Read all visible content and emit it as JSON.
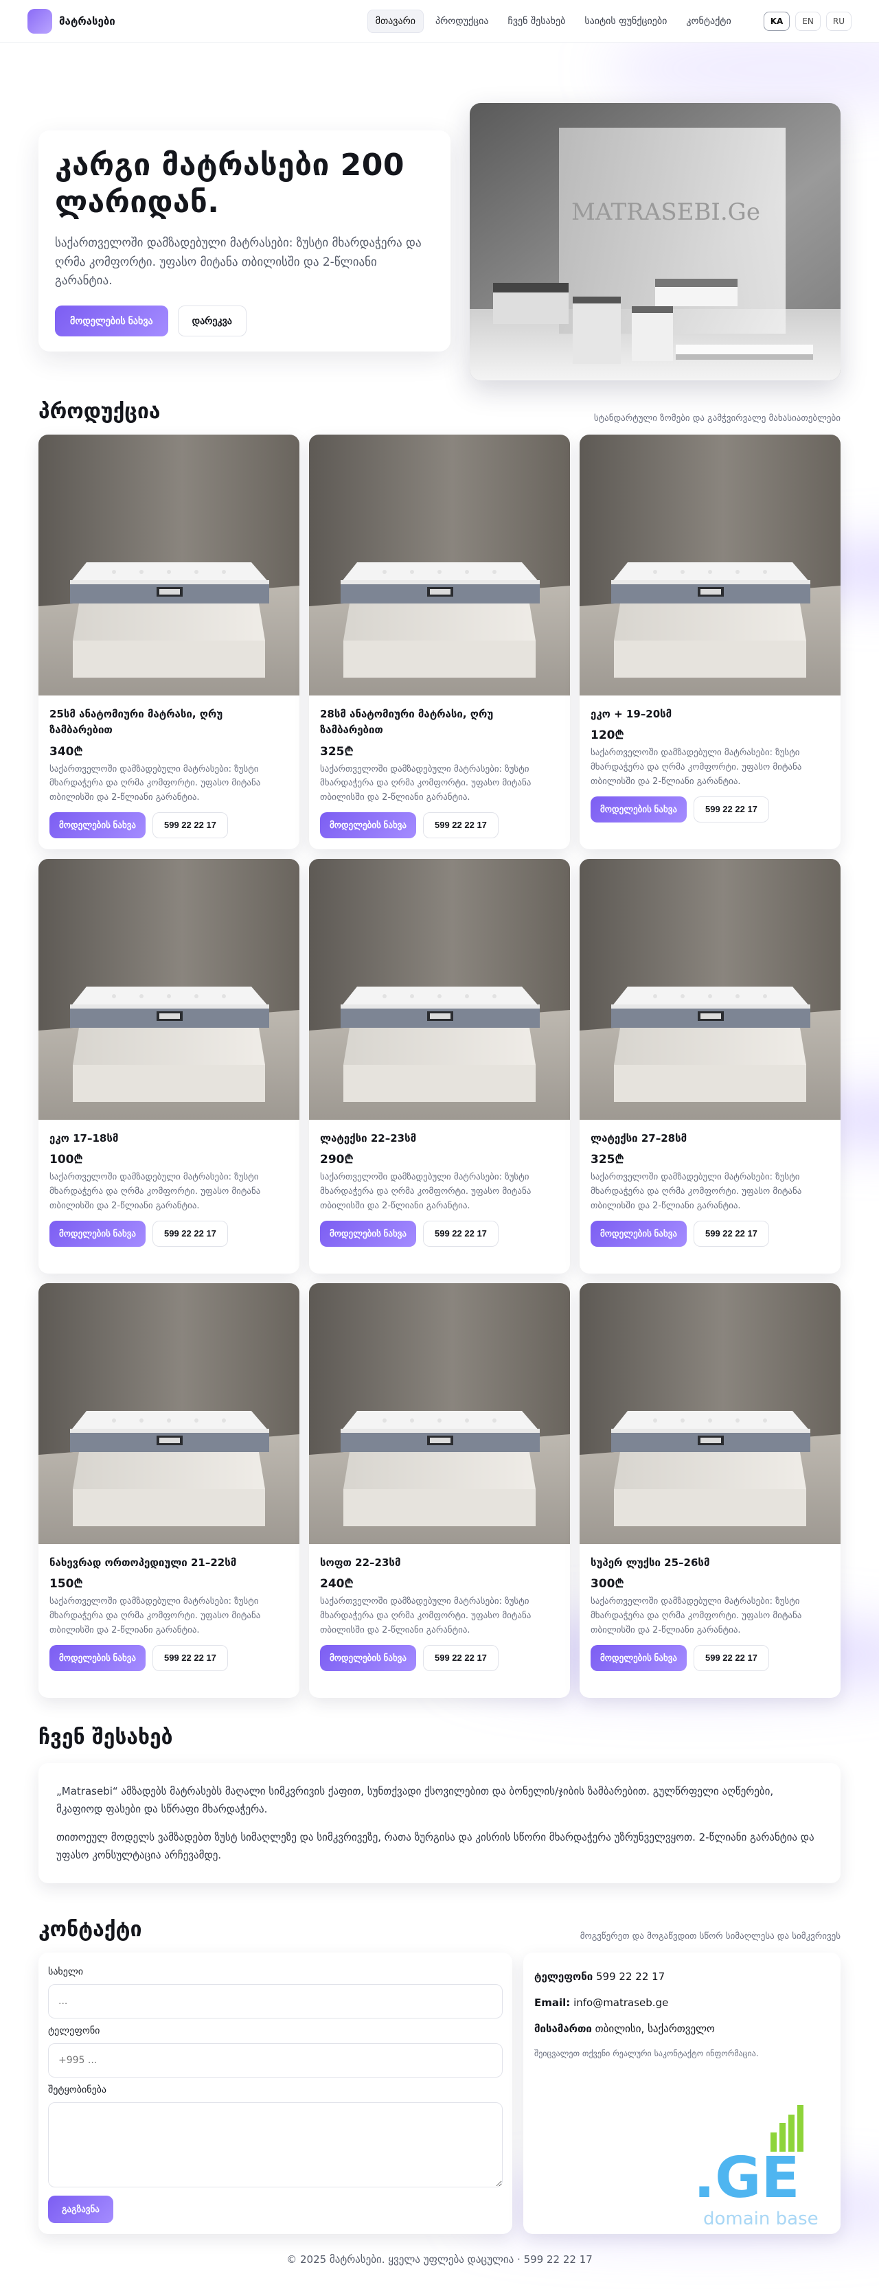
{
  "brand": {
    "name": "მატრასები"
  },
  "nav": {
    "items": [
      {
        "label": "მთავარი",
        "active": true
      },
      {
        "label": "პროდუქცია",
        "active": false
      },
      {
        "label": "ჩვენ შესახებ",
        "active": false
      },
      {
        "label": "საიტის ფუნქციები",
        "active": false
      },
      {
        "label": "კონტაქტი",
        "active": false
      }
    ],
    "languages": [
      {
        "label": "KA",
        "active": true
      },
      {
        "label": "EN",
        "active": false
      },
      {
        "label": "RU",
        "active": false
      }
    ]
  },
  "hero": {
    "title": "კარგი მატრასები 200 ლარიდან.",
    "text": "საქართველოში დამზადებული მატრასები: ზუსტი მხარდაჭერა და ღრმა კომფორტი. უფასო მიტანა თბილისში და 2-წლიანი გარანტია.",
    "primary_button": "მოდელების ნახვა",
    "secondary_button": "დარეკვა",
    "photo_brand": "MATRASEBI.Ge"
  },
  "products": {
    "title": "პროდუქცია",
    "subtitle": "სტანდარტული ზომები და გამჭვირვალე მახასიათებლები",
    "items": [
      {
        "name": "25სმ ანატომიური მატრასი, ღრუ ზამბარებით",
        "price": "340₾"
      },
      {
        "name": "28სმ ანატომიური მატრასი, ღრუ ზამბარებით",
        "price": "325₾"
      },
      {
        "name": "ეკო + 19–20სმ",
        "price": "120₾"
      },
      {
        "name": "ეკო 17–18სმ",
        "price": "100₾"
      },
      {
        "name": "ლატექსი 22–23სმ",
        "price": "290₾"
      },
      {
        "name": "ლატექსი 27–28სმ",
        "price": "325₾"
      },
      {
        "name": "ნახევრად ორთოპედიული 21–22სმ",
        "price": "150₾"
      },
      {
        "name": "სოფთ 22–23სმ",
        "price": "240₾"
      },
      {
        "name": "სუპერ ლუქსი 25–26სმ",
        "price": "300₾"
      }
    ],
    "description": "საქართველოში დამზადებული მატრასები: ზუსტი მხარდაჭერა და ღრმა კომფორტი. უფასო მიტანა თბილისში და 2-წლიანი გარანტია.",
    "view_label": "მოდელების ნახვა",
    "phone_label": "599 22 22 17"
  },
  "about": {
    "title": "ჩვენ შესახებ",
    "p1": "„Matrasebi“ ამზადებს მატრასებს მაღალი სიმკვრივის ქაფით, სუნთქვადი ქსოვილებით და ბონელის/ჯიბის ზამბარებით. გულწრფელი აღწერები, მკაფიოდ ფასები და სწრაფი მხარდაჭერა.",
    "p2": "თითოეულ მოდელს ვამზადებთ ზუსტ სიმაღლეზე და სიმკვრივეზე, რათა ზურგისა და კისრის სწორი მხარდაჭერა უზრუნველვყოთ. 2-წლიანი გარანტია და უფასო კონსულტაცია არჩევამდე."
  },
  "contact": {
    "title": "კონტაქტი",
    "subtitle": "მოგვწერეთ და მოგაწვდით სწორ სიმაღლესა და სიმკვრივეს",
    "form": {
      "name_label": "სახელი",
      "name_placeholder": "...",
      "phone_label": "ტელეფონი",
      "phone_placeholder": "+995 ...",
      "message_label": "შეტყობინება",
      "message_placeholder": "",
      "submit_label": "გაგზავნა"
    },
    "info": {
      "phone_label": "ტელეფონი",
      "phone_value": "599 22 22 17",
      "email_label": "Email:",
      "email_value": "info@matraseb.ge",
      "address_label": "მისამართი",
      "address_value": "თბილისი, საქართველო",
      "note": "შეიცვალეთ თქვენი რეალური საკონტაქტო ინფორმაცია."
    },
    "logo": {
      "big_text": ".GE",
      "small_text": "domain base"
    }
  },
  "footer": {
    "text": "© 2025 მატრასები. ყველა უფლება დაცულია · 599 22 22 17"
  },
  "colors": {
    "accent": "#7c5ef2",
    "accent_light": "#a48cff",
    "logo_blue": "#4fb5f0",
    "logo_green": "#8ed43a"
  }
}
